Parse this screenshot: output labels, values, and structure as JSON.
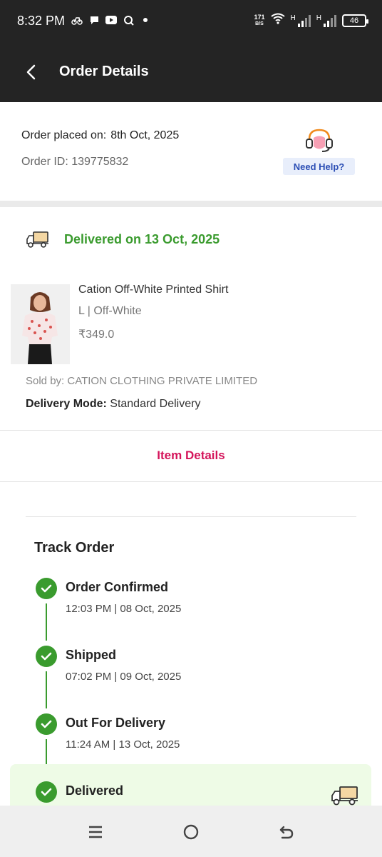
{
  "status_bar": {
    "time": "8:32 PM",
    "net_speed_value": "171",
    "net_speed_unit": "B/S",
    "signal_label_1": "H",
    "signal_label_2": "H",
    "battery": "46"
  },
  "header": {
    "title": "Order Details"
  },
  "order": {
    "placed_label": "Order placed on:",
    "placed_date": "8th Oct, 2025",
    "order_id_text": "Order ID: 139775832",
    "help_label": "Need Help?"
  },
  "delivery": {
    "status_text": "Delivered on 13 Oct, 2025",
    "product_name": "Cation Off-White Printed Shirt",
    "product_variant": "L | Off-White",
    "product_price": "₹349.0",
    "sold_by": "Sold by: CATION CLOTHING PRIVATE LIMITED",
    "mode_label": "Delivery Mode:",
    "mode_value": "Standard Delivery",
    "item_details_link": "Item Details"
  },
  "track": {
    "title": "Track Order",
    "steps": [
      {
        "label": "Order Confirmed",
        "time": "12:03 PM | 08 Oct, 2025"
      },
      {
        "label": "Shipped",
        "time": "07:02 PM | 09 Oct, 2025"
      },
      {
        "label": "Out For Delivery",
        "time": "11:24 AM | 13 Oct, 2025"
      },
      {
        "label": "Delivered",
        "time": ""
      }
    ]
  },
  "colors": {
    "header_bg": "#242424",
    "success_green": "#3a9b2e",
    "link_pink": "#d4145a",
    "help_blue": "#2c4fb5"
  }
}
